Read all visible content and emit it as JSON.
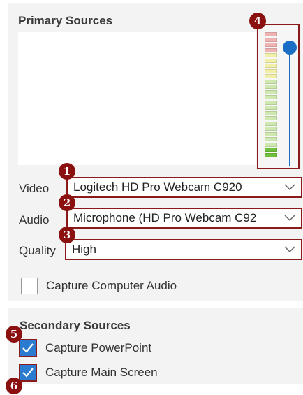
{
  "primary": {
    "title": "Primary Sources",
    "meter_level": 0.1,
    "meter_segments": [
      "#f0b3b3",
      "#f0b3b3",
      "#f0b3b3",
      "#f0b3b3",
      "#f2f0a8",
      "#f2f0a8",
      "#f2f0a8",
      "#f2f0a8",
      "#f2f0a8",
      "#cfe8b0",
      "#cfe8b0",
      "#cfe8b0",
      "#cfe8b0",
      "#cfe8b0",
      "#cfe8b0",
      "#cfe8b0",
      "#cfe8b0",
      "#cfe8b0",
      "#cfe8b0",
      "#cfe8b0",
      "#cfe8b0",
      "#cfe8b0",
      "#6ebf3a",
      "#6ebf3a"
    ],
    "video": {
      "label": "Video",
      "value": "Logitech HD Pro Webcam C920"
    },
    "audio": {
      "label": "Audio",
      "value": "Microphone (HD Pro Webcam C92"
    },
    "quality": {
      "label": "Quality",
      "value": "High"
    },
    "capture_audio": {
      "label": "Capture Computer Audio",
      "checked": false
    }
  },
  "secondary": {
    "title": "Secondary Sources",
    "powerpoint": {
      "label": "Capture PowerPoint",
      "checked": true
    },
    "main_screen": {
      "label": "Capture Main Screen",
      "checked": true
    }
  },
  "callouts": [
    "1",
    "2",
    "3",
    "4",
    "5",
    "6"
  ],
  "colors": {
    "accent": "#2b7bd0",
    "callout": "#8b1010",
    "highlight_border": "#8b1a1a"
  }
}
